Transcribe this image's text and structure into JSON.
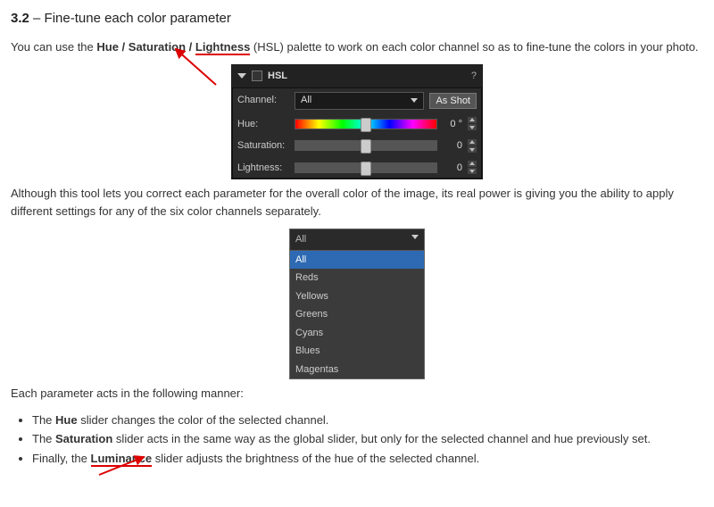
{
  "heading": {
    "number": "3.2",
    "sep": " – ",
    "title": "Fine-tune each color parameter"
  },
  "p1": {
    "t1": "You can use the ",
    "bold1": "Hue / Saturation / ",
    "bold_under": "Lightness",
    "t2": " (HSL) palette to work on each color channel so as to fine-tune the colors in your photo."
  },
  "hsl_panel": {
    "title": "HSL",
    "help": "?",
    "channel_label": "Channel:",
    "channel_value": "All",
    "as_shot": "As Shot",
    "hue_label": "Hue:",
    "hue_value": "0 °",
    "sat_label": "Saturation:",
    "sat_value": "0",
    "light_label": "Lightness:",
    "light_value": "0"
  },
  "p2": "Although this tool lets you correct each parameter for the overall color of the image, its real power is giving you the ability to apply different settings for any of the six color channels separately.",
  "dropdown": {
    "head": "All",
    "items": [
      "All",
      "Reds",
      "Yellows",
      "Greens",
      "Cyans",
      "Blues",
      "Magentas"
    ],
    "selected_index": 0
  },
  "p3": "Each parameter acts in the following manner:",
  "bullets": {
    "b1": {
      "t1": "The ",
      "bold": "Hue",
      "t2": " slider changes the color of the selected channel."
    },
    "b2": {
      "t1": "The ",
      "bold": "Saturation",
      "t2": " slider acts in the same way as the global slider, but only for the selected channel and hue previously set."
    },
    "b3": {
      "t1": "Finally, the ",
      "bold": "Luminance",
      "t2": " slider adjusts the brightness of the hue of the selected channel."
    }
  }
}
